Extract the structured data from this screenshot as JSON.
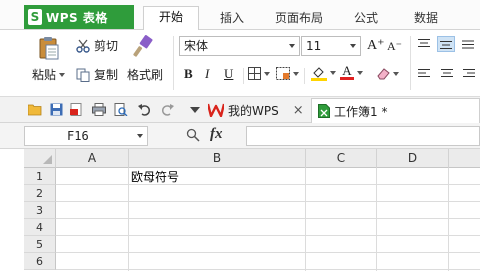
{
  "app": {
    "title": "WPS 表格",
    "logo_letter": "S"
  },
  "menu_tabs": [
    {
      "label": "开始",
      "active": true
    },
    {
      "label": "插入",
      "active": false
    },
    {
      "label": "页面布局",
      "active": false
    },
    {
      "label": "公式",
      "active": false
    },
    {
      "label": "数据",
      "active": false
    }
  ],
  "ribbon": {
    "paste_label": "粘贴",
    "cut_label": "剪切",
    "copy_label": "复制",
    "format_painter_label": "格式刷",
    "font_name": "宋体",
    "font_size": "11",
    "bold": "B",
    "italic": "I",
    "underline": "U",
    "grow_font": "A⁺",
    "shrink_font": "A⁻",
    "font_color_glyph": "A"
  },
  "doc_tabs": [
    {
      "label": "我的WPS",
      "close": "×"
    },
    {
      "label": "工作簿1 *"
    }
  ],
  "formula_bar": {
    "name_box": "F16",
    "fx_label": "fx"
  },
  "sheet": {
    "columns": [
      "A",
      "B",
      "C",
      "D"
    ],
    "rows": [
      "1",
      "2",
      "3",
      "4",
      "5",
      "6"
    ],
    "cells": {
      "B1": "欧母符号"
    }
  },
  "colors": {
    "brand_green": "#2f9c3b",
    "wps_red": "#d9241c",
    "font_color_bar": "#e02020",
    "fill_color_bar": "#ffd400"
  }
}
